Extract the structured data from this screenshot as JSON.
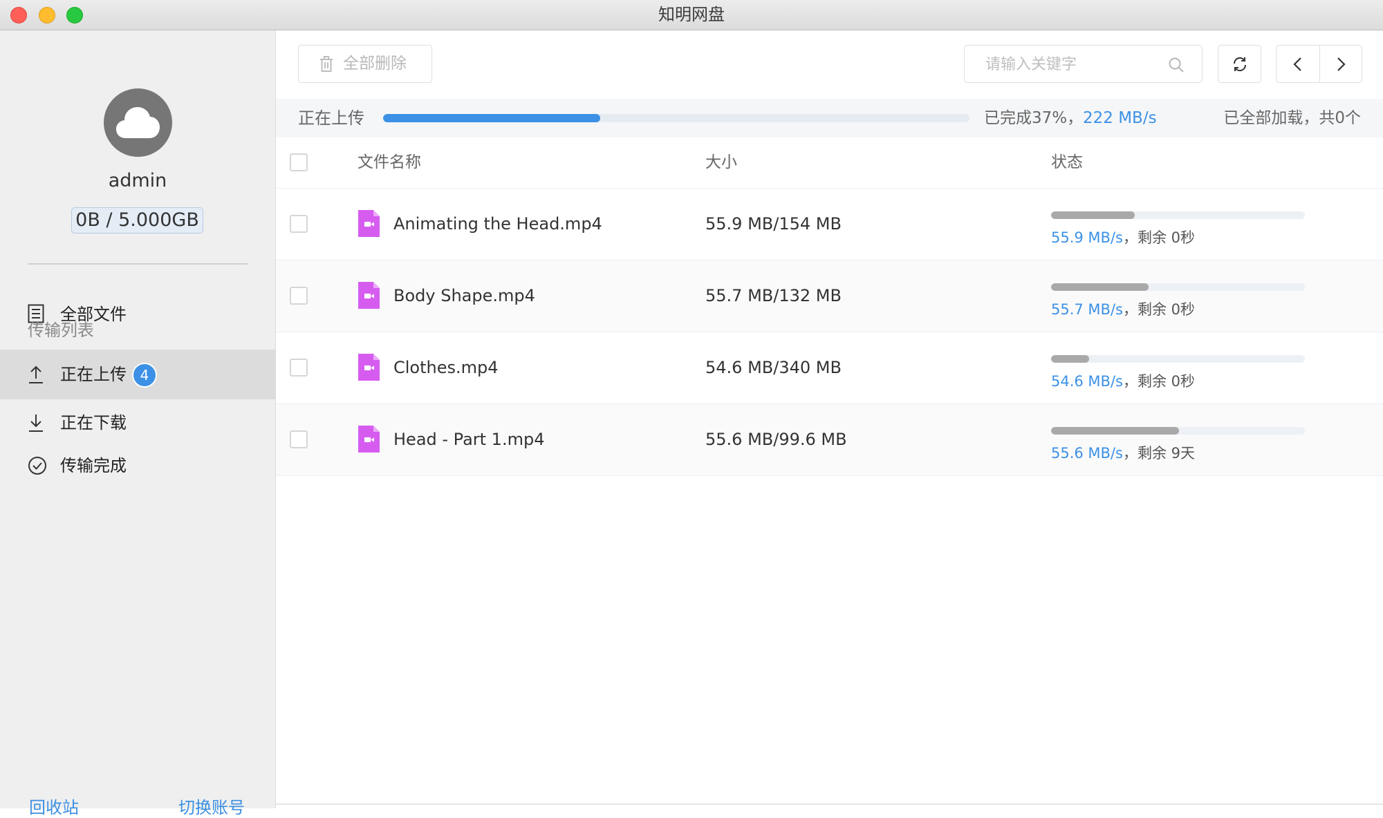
{
  "window": {
    "title": "知明网盘"
  },
  "sidebar": {
    "username": "admin",
    "quota": "0B / 5.000GB",
    "all_files_label": "全部文件",
    "section_title": "传输列表",
    "items": [
      {
        "label": "正在上传",
        "icon": "upload-icon",
        "badge": "4",
        "active": true
      },
      {
        "label": "正在下载",
        "icon": "download-icon",
        "active": false
      },
      {
        "label": "传输完成",
        "icon": "check-circle-icon",
        "active": false
      }
    ],
    "recycle_bin_label": "回收站",
    "switch_account_label": "切换账号"
  },
  "toolbar": {
    "delete_all_label": "全部删除",
    "search_placeholder": "请输入关键字",
    "search_value": ""
  },
  "upload_summary": {
    "label": "正在上传",
    "progress_percent": 37,
    "completed_text": "已完成37%，",
    "speed": "222 MB/s",
    "loaded_text": "已全部加载，共0个"
  },
  "table": {
    "columns": [
      "文件名称",
      "大小",
      "状态"
    ],
    "rows": [
      {
        "name": "Animating the Head.mp4",
        "size": "55.9 MB/154 MB",
        "progress": 0.33,
        "speed": "55.9 MB/s",
        "remaining": "，剩余 0秒"
      },
      {
        "name": "Body Shape.mp4",
        "size": "55.7 MB/132 MB",
        "progress": 0.385,
        "speed": "55.7 MB/s",
        "remaining": "，剩余 0秒"
      },
      {
        "name": "Clothes.mp4",
        "size": "54.6 MB/340 MB",
        "progress": 0.15,
        "speed": "54.6 MB/s",
        "remaining": "，剩余 0秒"
      },
      {
        "name": "Head - Part 1.mp4",
        "size": "55.6 MB/99.6 MB",
        "progress": 0.505,
        "speed": "55.6 MB/s",
        "remaining": "，剩余 9天"
      }
    ]
  },
  "colors": {
    "accent": "#3c91e6",
    "file_icon": "#d65cf0",
    "row_progress": "#a9a9a9"
  }
}
